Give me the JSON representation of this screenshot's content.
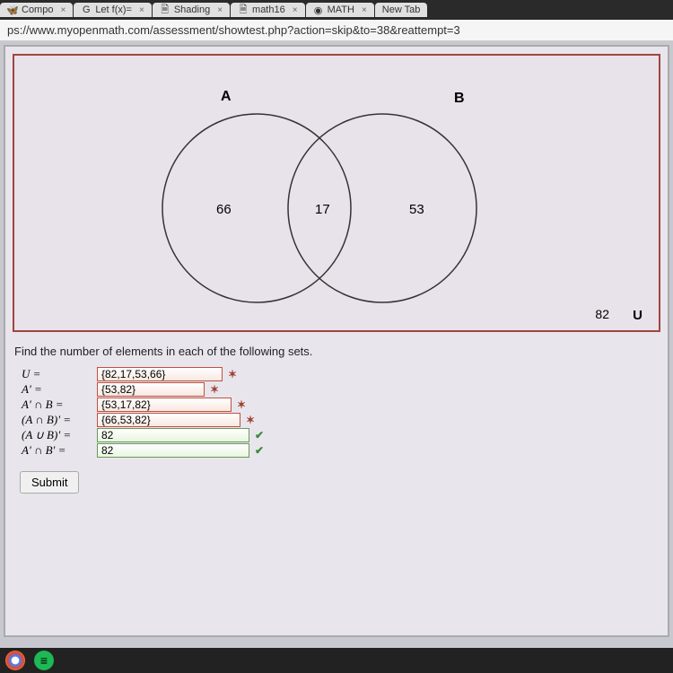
{
  "tabs": [
    {
      "label": "Compo",
      "close": "×"
    },
    {
      "label": "Let f(x)=",
      "close": "×"
    },
    {
      "label": "Shading",
      "close": "×"
    },
    {
      "label": "math16",
      "close": "×"
    },
    {
      "label": "MATH",
      "close": "×"
    },
    {
      "label": "New Tab",
      "close": ""
    }
  ],
  "url": "ps://www.myopenmath.com/assessment/showtest.php?action=skip&to=38&reattempt=3",
  "venn": {
    "labelA": "A",
    "labelB": "B",
    "labelU": "U",
    "onlyA": "66",
    "intersection": "17",
    "onlyB": "53",
    "outside": "82"
  },
  "problem": "Find the number of elements in each of the following sets.",
  "answers": [
    {
      "label": "U =",
      "value": "{82,17,53,66}",
      "cls": "input-red",
      "mark": "✶",
      "markCls": "mark-x"
    },
    {
      "label": "A' =",
      "value": "{53,82}",
      "cls": "input-red input-red2",
      "mark": "✶",
      "markCls": "mark-x"
    },
    {
      "label": "A' ∩ B =",
      "value": "{53,17,82}",
      "cls": "input-red input-red3",
      "mark": "✶",
      "markCls": "mark-x"
    },
    {
      "label": "(A ∩ B)' =",
      "value": "{66,53,82}",
      "cls": "input-red input-red4",
      "mark": "✶",
      "markCls": "mark-x"
    },
    {
      "label": "(A ∪ B)' =",
      "value": "82",
      "cls": "input-green",
      "mark": "✔",
      "markCls": "mark-check"
    },
    {
      "label": "A' ∩ B' =",
      "value": "82",
      "cls": "input-green",
      "mark": "✔",
      "markCls": "mark-check"
    }
  ],
  "submit": "Submit",
  "chart_data": {
    "type": "venn",
    "sets": [
      "A",
      "B"
    ],
    "universal": "U",
    "regions": {
      "A_only": 66,
      "A_and_B": 17,
      "B_only": 53,
      "outside": 82
    }
  }
}
